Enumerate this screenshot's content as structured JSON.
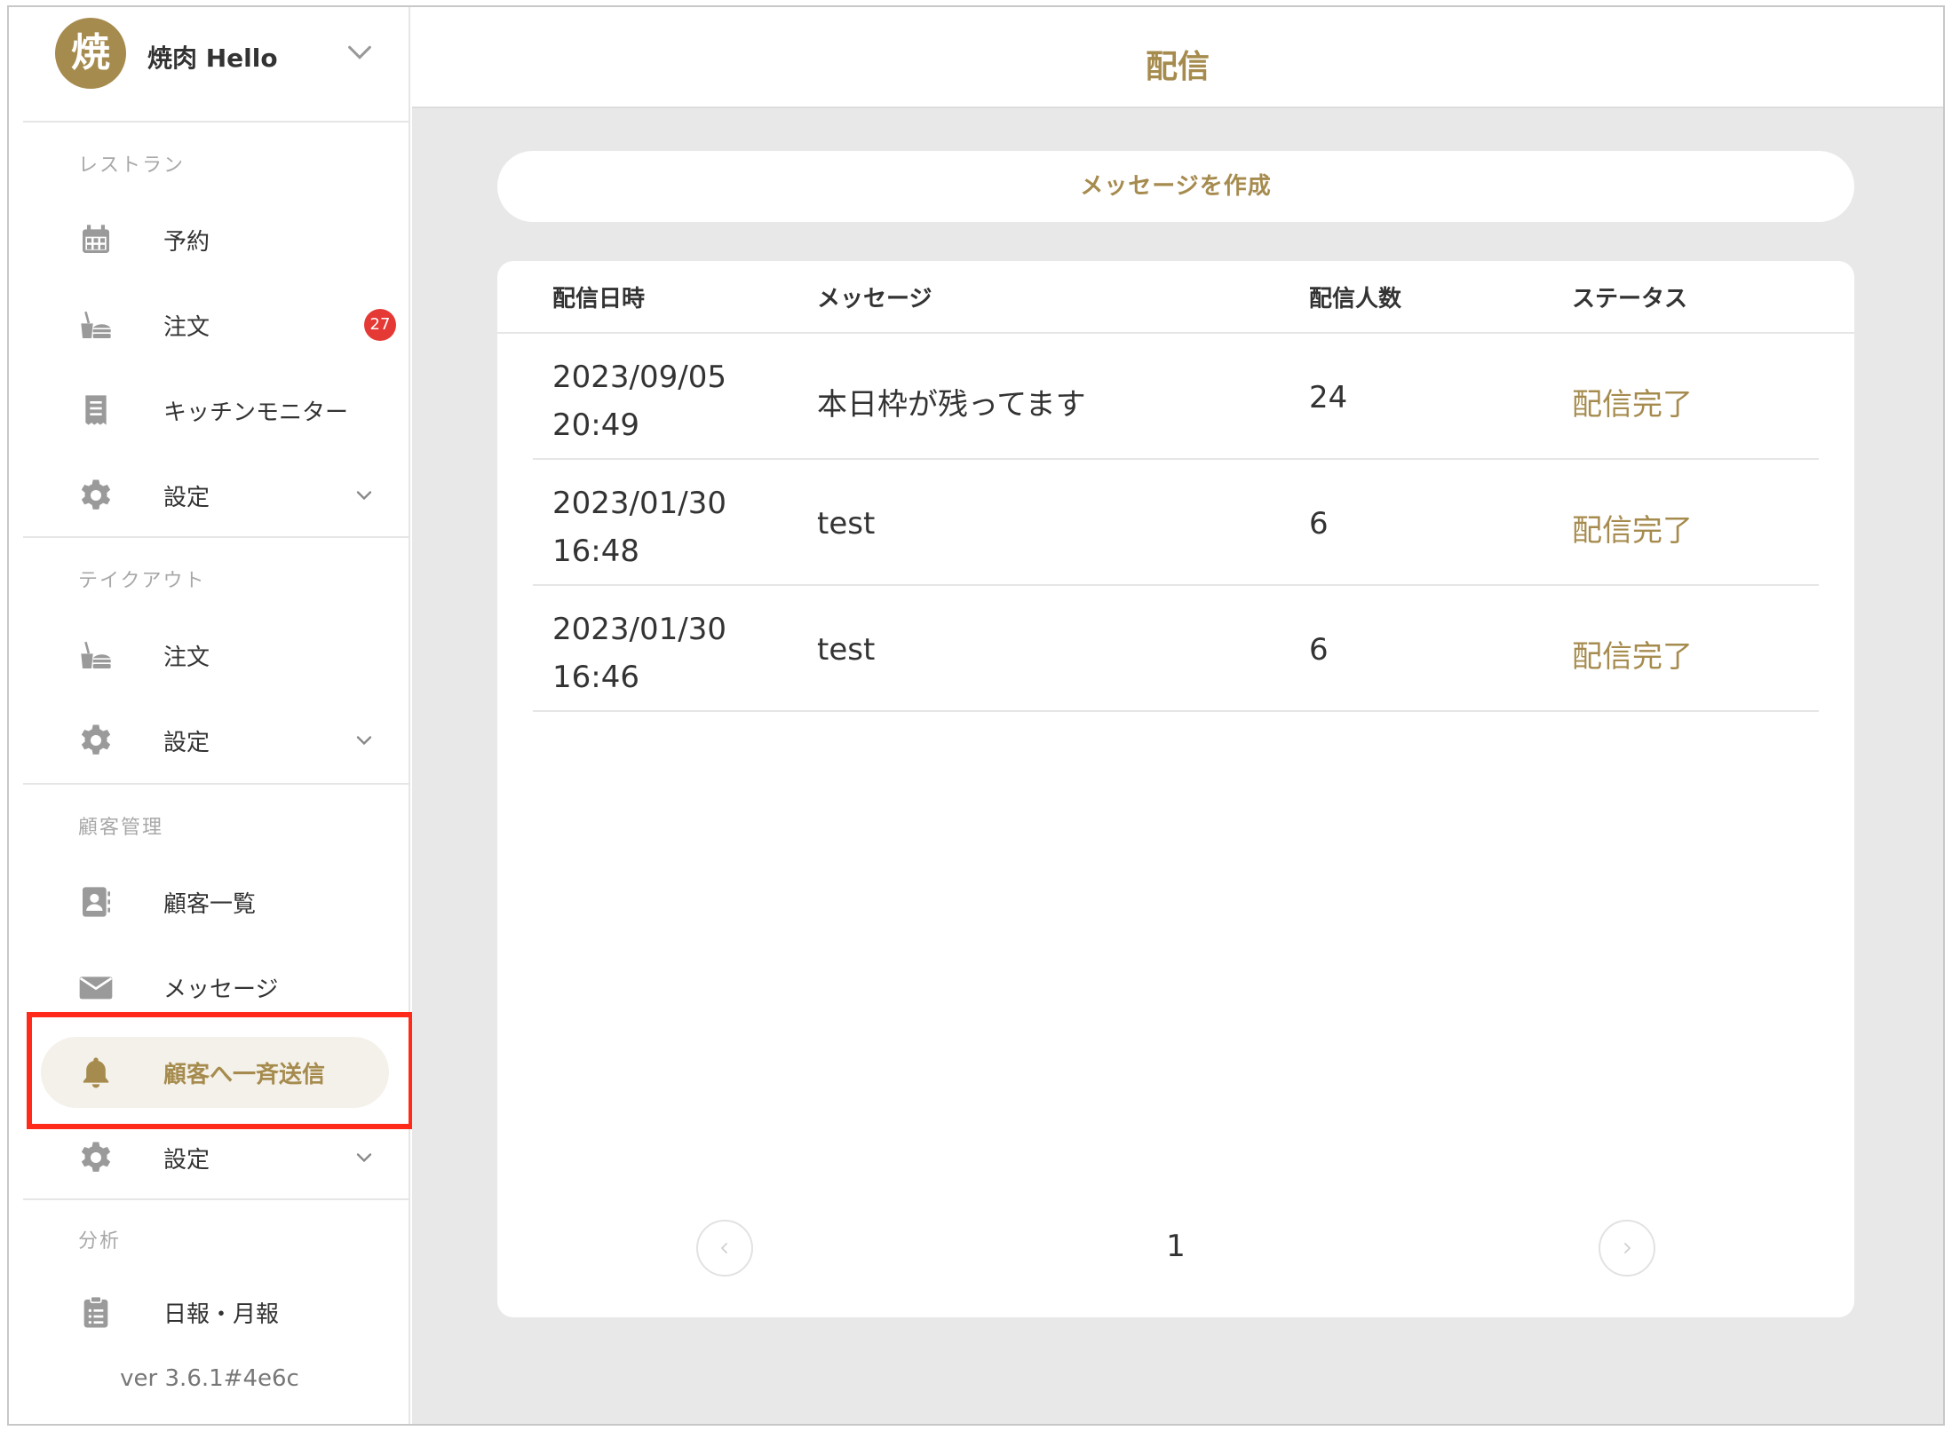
{
  "brand": {
    "logo_char": "焼",
    "name": "焼肉 Hello"
  },
  "sidebar": {
    "sections": [
      {
        "label": "レストラン"
      },
      {
        "label": "テイクアウト"
      },
      {
        "label": "顧客管理"
      },
      {
        "label": "分析"
      }
    ],
    "items": [
      {
        "label": "予約",
        "icon": "calendar-icon"
      },
      {
        "label": "注文",
        "icon": "order-icon",
        "badge": "27"
      },
      {
        "label": "キッチンモニター",
        "icon": "receipt-icon"
      },
      {
        "label": "設定",
        "icon": "gear-icon"
      },
      {
        "label": "注文",
        "icon": "order-icon"
      },
      {
        "label": "設定",
        "icon": "gear-icon"
      },
      {
        "label": "顧客一覧",
        "icon": "contacts-icon"
      },
      {
        "label": "メッセージ",
        "icon": "mail-icon"
      },
      {
        "label": "顧客へ一斉送信",
        "icon": "bell-icon",
        "active": true
      },
      {
        "label": "設定",
        "icon": "gear-icon"
      },
      {
        "label": "日報・月報",
        "icon": "clipboard-icon"
      }
    ],
    "version": "ver 3.6.1#4e6c"
  },
  "header": {
    "title": "配信"
  },
  "compose_button": "メッセージを作成",
  "table": {
    "columns": [
      "配信日時",
      "メッセージ",
      "配信人数",
      "ステータス"
    ],
    "rows": [
      {
        "date": "2023/09/05",
        "time": "20:49",
        "message": "本日枠が残ってます",
        "count": "24",
        "status": "配信完了"
      },
      {
        "date": "2023/01/30",
        "time": "16:48",
        "message": "test",
        "count": "6",
        "status": "配信完了"
      },
      {
        "date": "2023/01/30",
        "time": "16:46",
        "message": "test",
        "count": "6",
        "status": "配信完了"
      }
    ]
  },
  "pagination": {
    "current_page": "1"
  },
  "colors": {
    "accent": "#a68b4e",
    "badge": "#e53935",
    "highlight": "#ff2a1a",
    "icon_gray": "#9a9a9a"
  }
}
